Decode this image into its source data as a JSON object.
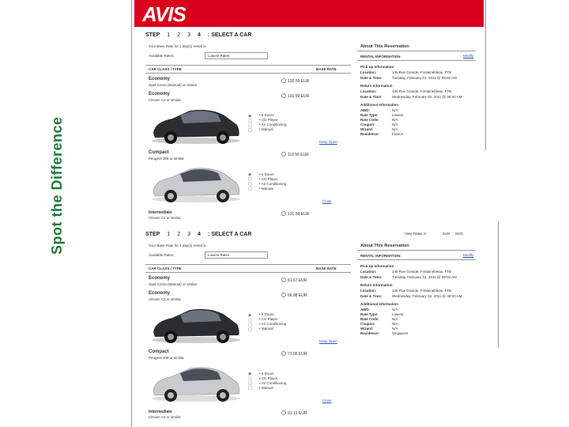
{
  "side_title": "Spot the Difference",
  "brand": {
    "logo": "AVIS",
    "color": "#d9001c"
  },
  "panels": [
    {
      "steps": [
        "STEP",
        "1",
        "2",
        "3",
        "4",
        ": SELECT A CAR"
      ],
      "base_rate_text": "Your Base Rate for 1 day(s) rental is:",
      "available_rates_label": "Available Rates:",
      "available_rates_value": "Lowest Rates",
      "col_class": "CAR CLASS / TYPE",
      "col_rate": "BASE RATE",
      "view_rates": "",
      "rows": [
        {
          "name": "Economy",
          "desc": "Opel Corsa (Manual) or similar",
          "price": "100.59 EUR"
        },
        {
          "name": "Economy",
          "desc": "Citroen C3 or similar",
          "price": "101.59 EUR"
        },
        {
          "name": "Compact",
          "desc": "Peugeot 308 or similar",
          "price": "110.56 EUR"
        },
        {
          "name": "Intermediate",
          "desc": "Citroen C4 or similar",
          "price": "131.58 EUR"
        }
      ],
      "features_a": [
        "5 Doors",
        "CD Player",
        "Air Conditioning",
        "Manual"
      ],
      "features_b": [
        "5 Doors",
        "CD Player",
        "Air Conditioning",
        "Manual"
      ],
      "keep_open": "Keep Open",
      "close": "Close",
      "about_title": "About This Reservation",
      "rental_info": "RENTAL INFORMATION",
      "modify": "Modify",
      "pickup_title": "Pick-up Information",
      "pickup_location_label": "Location:",
      "pickup_location": "135 Rue Grande, Fontainebleau, FTB",
      "pickup_date_label": "Date & Time:",
      "pickup_date": "Tuesday, February 01, 2011 @ 09:00 AM",
      "return_title": "Return Information",
      "return_location_label": "Location:",
      "return_location": "135 Rue Grande, Fontainebleau, FTB",
      "return_date_label": "Date & Time:",
      "return_date": "Wednesday, February 02, 2011 @ 09:00 AM",
      "additional_title": "Additional Information",
      "additional": [
        [
          "AWD:",
          "N/A"
        ],
        [
          "Rate Type:",
          "Lowest"
        ],
        [
          "Rate Code:",
          "N/A"
        ],
        [
          "Coupon:",
          "N/A"
        ],
        [
          "Wizard:",
          "N/A"
        ],
        [
          "Residence:",
          "France"
        ]
      ]
    },
    {
      "steps": [
        "STEP",
        "1",
        "2",
        "3",
        "4",
        ": SELECT A CAR"
      ],
      "base_rate_text": "Your Base Rate for 1 day(s) rental is:",
      "available_rates_label": "Available Rates:",
      "available_rates_value": "Lowest Rates",
      "col_class": "CAR CLASS / TYPE",
      "col_rate": "BASE RATE",
      "view_rates": "View Rates in:",
      "view_rates_opts": [
        "EUR",
        "SGD"
      ],
      "rows": [
        {
          "name": "Economy",
          "desc": "Opel Corsa (Manual) or similar",
          "price": "61.67 EUR"
        },
        {
          "name": "Economy",
          "desc": "Citroen C3 or similar",
          "price": "66.88 EUR"
        },
        {
          "name": "Compact",
          "desc": "Peugeot 308 or similar",
          "price": "71.06 EUR"
        },
        {
          "name": "Intermediate",
          "desc": "Citroen C4 or similar",
          "price": "91.13 EUR"
        }
      ],
      "features_a": [
        "5 Doors",
        "CD Player",
        "Air Conditioning",
        "Manual"
      ],
      "features_b": [
        "5 Doors",
        "CD Player",
        "Air Conditioning",
        "Manual"
      ],
      "keep_open": "Keep Open",
      "close": "Close",
      "about_title": "About This Reservation",
      "rental_info": "RENTAL INFORMATION",
      "modify": "Modify",
      "pickup_title": "Pick-up Information",
      "pickup_location_label": "Location:",
      "pickup_location": "135 Rue Grande, Fontainebleau, FTB",
      "pickup_date_label": "Date & Time:",
      "pickup_date": "Tuesday, February 01, 2011 @ 09:00 AM",
      "return_title": "Return Information",
      "return_location_label": "Location:",
      "return_location": "135 Rue Grande, Fontainebleau, FTB",
      "return_date_label": "Date & Time:",
      "return_date": "Wednesday, February 02, 2011 @ 09:00 AM",
      "additional_title": "Additional Information",
      "additional": [
        [
          "AWD:",
          "N/A"
        ],
        [
          "Rate Type:",
          "Lowest"
        ],
        [
          "Rate Code:",
          "N/A"
        ],
        [
          "Coupon:",
          "N/A"
        ],
        [
          "Wizard:",
          "N/A"
        ],
        [
          "Residence:",
          "Singapore"
        ]
      ]
    }
  ]
}
